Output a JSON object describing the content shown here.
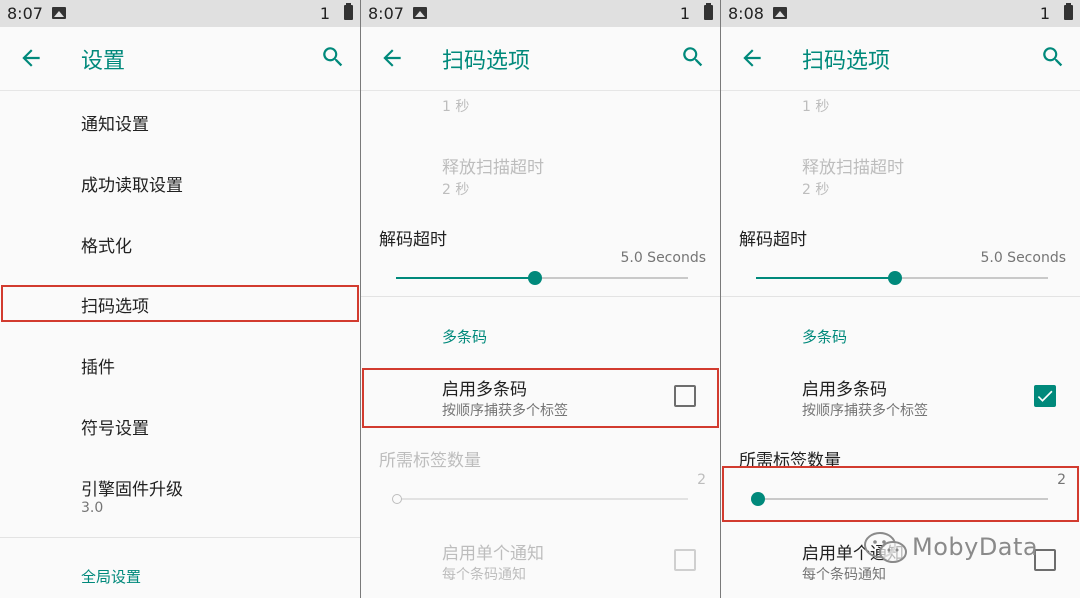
{
  "colors": {
    "accent": "#00897b",
    "highlight": "#d23b2f"
  },
  "panel1": {
    "status": {
      "time": "8:07",
      "sim": "1"
    },
    "title": "设置",
    "items": [
      {
        "title": "通知设置"
      },
      {
        "title": "成功读取设置"
      },
      {
        "title": "格式化"
      },
      {
        "title": "扫码选项"
      },
      {
        "title": "插件"
      },
      {
        "title": "符号设置"
      },
      {
        "title": "引擎固件升级",
        "subtitle": "3.0"
      }
    ],
    "category": "全局设置"
  },
  "panel2": {
    "status": {
      "time": "8:07",
      "sim": "1"
    },
    "title": "扫码选项",
    "top_sub": "1 秒",
    "release_timeout": {
      "title": "释放扫描超时",
      "subtitle": "2 秒"
    },
    "decode_timeout": {
      "title": "解码超时",
      "value": "5.0 Seconds",
      "level_fraction": 0.5
    },
    "category": "多条码",
    "enable_multi": {
      "title": "启用多条码",
      "subtitle": "按顺序捕获多个标签",
      "checked": false
    },
    "required_count": {
      "title": "所需标签数量",
      "value": "2"
    },
    "single_notify": {
      "title": "启用单个通知",
      "subtitle": "每个条码通知",
      "checked": false
    }
  },
  "panel3": {
    "status": {
      "time": "8:08",
      "sim": "1"
    },
    "title": "扫码选项",
    "top_sub": "1 秒",
    "release_timeout": {
      "title": "释放扫描超时",
      "subtitle": "2 秒"
    },
    "decode_timeout": {
      "title": "解码超时",
      "value": "5.0 Seconds",
      "level_fraction": 0.5
    },
    "category": "多条码",
    "enable_multi": {
      "title": "启用多条码",
      "subtitle": "按顺序捕获多个标签",
      "checked": true
    },
    "required_count": {
      "title": "所需标签数量",
      "value": "2"
    },
    "single_notify": {
      "title": "启用单个通知",
      "subtitle": "每个条码通知",
      "checked": false
    }
  },
  "icons": {
    "back": "arrow-left-icon",
    "search": "magnifier-icon",
    "image": "image-notification-icon",
    "battery": "battery-icon",
    "check": "check-icon",
    "wechat": "wechat-icon"
  },
  "watermark": {
    "text": "MobyData"
  }
}
